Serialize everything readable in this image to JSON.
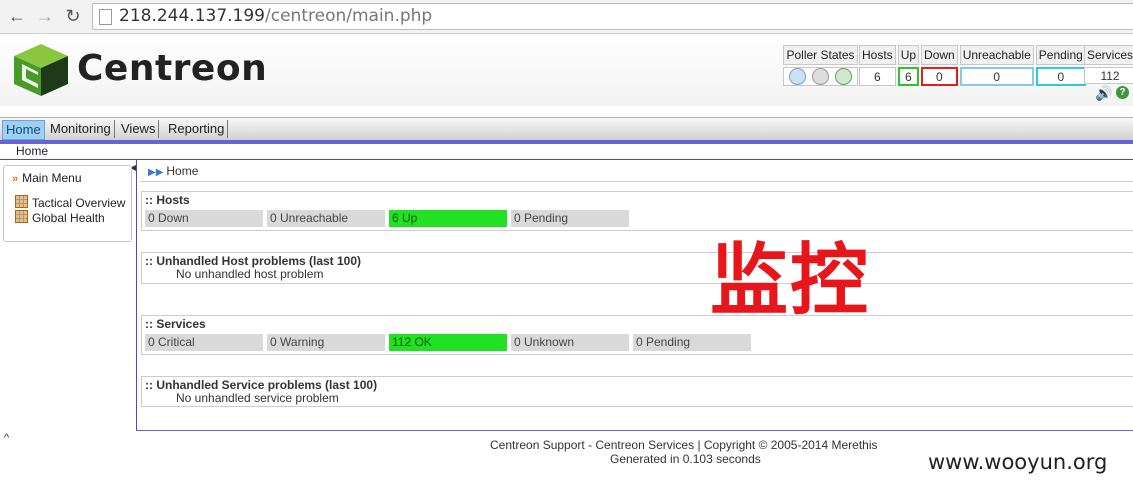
{
  "browser": {
    "url_host": "218.244.137.199",
    "url_path": "/centreon/main.php"
  },
  "header": {
    "logo_text": "Centreon",
    "poller": {
      "label": "Poller States"
    },
    "hosts": {
      "headers": [
        "Hosts",
        "Up",
        "Down",
        "Unreachable",
        "Pending"
      ],
      "values": [
        "6",
        "6",
        "0",
        "0",
        "0"
      ]
    },
    "services": {
      "header": "Services",
      "value": "112"
    },
    "colors": {
      "up": "#2ec22e",
      "down": "#e02020",
      "unreachable": "#88c8e8",
      "pending": "#2ec8e0"
    }
  },
  "menu": {
    "items": [
      "Home",
      "Monitoring",
      "Views",
      "Reporting"
    ],
    "active": "Home",
    "sub": "Home"
  },
  "sidebar": {
    "title": "Main Menu",
    "items": [
      "Tactical Overview",
      "Global Health"
    ]
  },
  "content": {
    "breadcrumb": "Home",
    "hosts_box": {
      "title": ":: Hosts",
      "cells": [
        "0 Down",
        "0 Unreachable",
        "6 Up",
        "0 Pending"
      ]
    },
    "host_problems": {
      "title": ":: Unhandled Host problems (last 100)",
      "message": "No unhandled host problem"
    },
    "services_box": {
      "title": ":: Services",
      "cells": [
        "0 Critical",
        "0 Warning",
        "112 OK",
        "0 Unknown",
        "0 Pending"
      ]
    },
    "service_problems": {
      "title": ":: Unhandled Service problems (last 100)",
      "message": "No unhandled service problem"
    },
    "overlay_text": "监控"
  },
  "footer": {
    "line1": "Centreon Support - Centreon Services | Copyright © 2005-2014 Merethis",
    "line2": "Generated in 0.103 seconds",
    "watermark": "www.wooyun.org"
  }
}
